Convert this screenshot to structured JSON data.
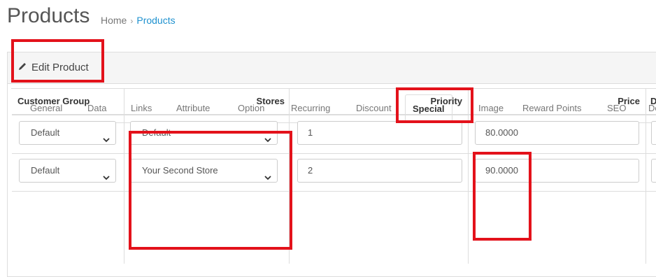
{
  "header": {
    "title": "Products",
    "breadcrumb": {
      "home": "Home",
      "separator": "›",
      "current": "Products"
    }
  },
  "panel": {
    "title": "Edit Product",
    "title_icon": "pencil-icon"
  },
  "tabs": [
    {
      "label": "General"
    },
    {
      "label": "Data"
    },
    {
      "label": "Links"
    },
    {
      "label": "Attribute"
    },
    {
      "label": "Option"
    },
    {
      "label": "Recurring"
    },
    {
      "label": "Discount"
    },
    {
      "label": "Special",
      "active": true
    },
    {
      "label": "Image"
    },
    {
      "label": "Reward Points"
    },
    {
      "label": "SEO"
    },
    {
      "label": "De"
    }
  ],
  "table": {
    "headers": {
      "customer_group": "Customer Group",
      "stores": "Stores",
      "priority": "Priority",
      "price": "Price",
      "date": "D"
    },
    "rows": [
      {
        "customer_group": "Default",
        "store": "Default",
        "priority": "1",
        "price": "80.0000"
      },
      {
        "customer_group": "Default",
        "store": "Your Second Store",
        "priority": "2",
        "price": "90.0000"
      }
    ]
  },
  "colors": {
    "accent": "#1e91cf",
    "highlight": "#e3121b",
    "heading_bg": "#f5f5f5"
  }
}
